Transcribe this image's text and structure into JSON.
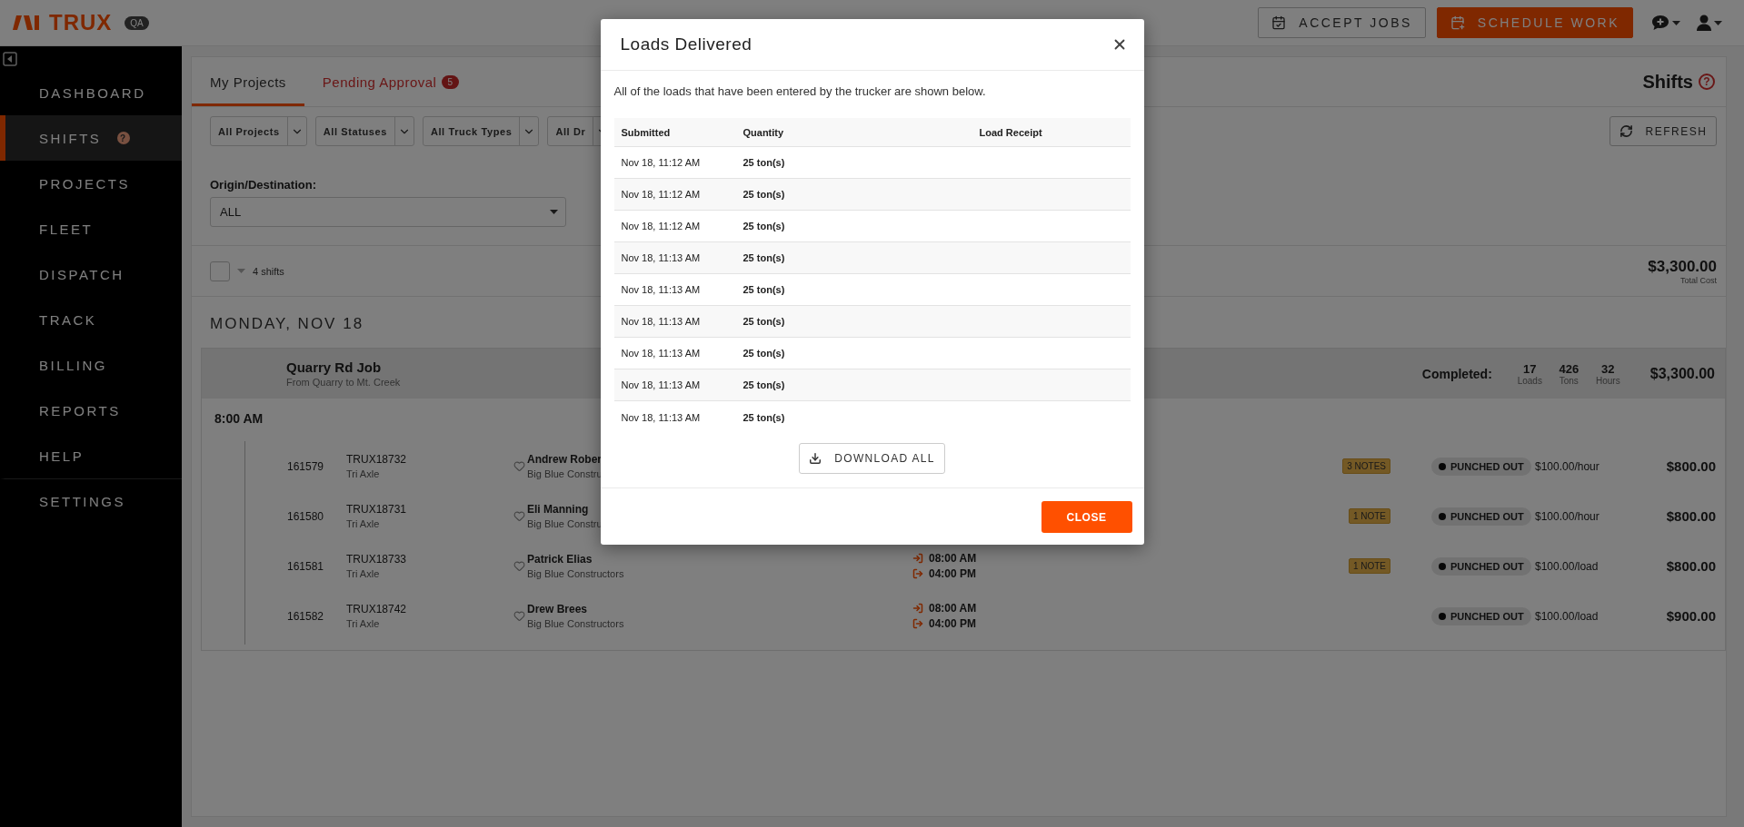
{
  "header": {
    "logo": "TRUX",
    "env_badge": "QA",
    "buttons": [
      {
        "label": "ACCEPT JOBS",
        "kind": "outline"
      },
      {
        "label": "SCHEDULE WORK",
        "kind": "primary"
      }
    ]
  },
  "sidebar": {
    "items": [
      {
        "label": "DASHBOARD",
        "selected": false,
        "has_help": false,
        "divider_before": false
      },
      {
        "label": "SHIFTS",
        "selected": true,
        "has_help": true,
        "help_mark": "?",
        "divider_before": false
      },
      {
        "label": "PROJECTS",
        "selected": false,
        "has_help": false,
        "divider_before": false
      },
      {
        "label": "FLEET",
        "selected": false,
        "has_help": false,
        "divider_before": false
      },
      {
        "label": "DISPATCH",
        "selected": false,
        "has_help": false,
        "divider_before": false
      },
      {
        "label": "TRACK",
        "selected": false,
        "has_help": false,
        "divider_before": false
      },
      {
        "label": "BILLING",
        "selected": false,
        "has_help": false,
        "divider_before": false
      },
      {
        "label": "REPORTS",
        "selected": false,
        "has_help": false,
        "divider_before": false
      },
      {
        "label": "HELP",
        "selected": false,
        "has_help": false,
        "divider_before": false
      },
      {
        "label": "SETTINGS",
        "selected": false,
        "has_help": false,
        "divider_before": true
      }
    ]
  },
  "tabs": [
    {
      "label": "My Projects",
      "selected": true
    },
    {
      "label": "Pending Approval",
      "selected": false,
      "badge": "5"
    }
  ],
  "page_title": "Shifts",
  "page_help": "?",
  "filters": [
    "All Projects",
    "All Statuses",
    "All Truck Types",
    "All Dr"
  ],
  "refresh_button": "REFRESH",
  "origin_destination": {
    "label": "Origin/Destination:",
    "value": "ALL"
  },
  "summary": {
    "select_all_checked": false,
    "count": "4 shifts",
    "total": "$3,300.00",
    "total_label": "Total Cost"
  },
  "day": {
    "heading": "MONDAY, NOV 18",
    "job": {
      "title": "Quarry Rd Job",
      "route": "From Quarry to Mt. Creek",
      "completed_label": "Completed:",
      "stats": [
        {
          "value": "17",
          "label": "Loads"
        },
        {
          "value": "426",
          "label": "Tons"
        },
        {
          "value": "32",
          "label": "Hours"
        }
      ],
      "total": "$3,300.00"
    },
    "time_group": "8:00 AM",
    "shifts": [
      {
        "id": "161579",
        "truck": "TRUX18732",
        "truck_type": "Tri Axle",
        "driver": "Andrew Rober",
        "company": "Big Blue Constru",
        "notes": "3 NOTES",
        "status": "PUNCHED OUT",
        "rate": "$100.00/hour",
        "amount": "$800.00"
      },
      {
        "id": "161580",
        "truck": "TRUX18731",
        "truck_type": "Tri Axle",
        "driver": "Eli Manning",
        "company": "Big Blue Constru",
        "notes": "1 NOTE",
        "status": "PUNCHED OUT",
        "rate": "$100.00/hour",
        "amount": "$800.00"
      },
      {
        "id": "161581",
        "truck": "TRUX18733",
        "truck_type": "Tri Axle",
        "driver": "Patrick Elias",
        "company": "Big Blue Constructors",
        "times": [
          {
            "kind": "in",
            "time": "08:00 AM"
          },
          {
            "kind": "out",
            "time": "04:00 PM"
          }
        ],
        "notes": "1 NOTE",
        "status": "PUNCHED OUT",
        "rate": "$100.00/load",
        "amount": "$800.00"
      },
      {
        "id": "161582",
        "truck": "TRUX18742",
        "truck_type": "Tri Axle",
        "driver": "Drew Brees",
        "company": "Big Blue Constructors",
        "times": [
          {
            "kind": "in",
            "time": "08:00 AM"
          },
          {
            "kind": "out",
            "time": "04:00 PM"
          }
        ],
        "status": "PUNCHED OUT",
        "rate": "$100.00/load",
        "amount": "$900.00"
      }
    ]
  },
  "modal": {
    "title": "Loads Delivered",
    "description": "All of the loads that have been entered by the trucker are shown below.",
    "columns": [
      "Submitted",
      "Quantity",
      "Load Receipt"
    ],
    "rows": [
      {
        "submitted": "Nov 18, 11:12 AM",
        "quantity": "25 ton(s)"
      },
      {
        "submitted": "Nov 18, 11:12 AM",
        "quantity": "25 ton(s)"
      },
      {
        "submitted": "Nov 18, 11:12 AM",
        "quantity": "25 ton(s)"
      },
      {
        "submitted": "Nov 18, 11:13 AM",
        "quantity": "25 ton(s)"
      },
      {
        "submitted": "Nov 18, 11:13 AM",
        "quantity": "25 ton(s)"
      },
      {
        "submitted": "Nov 18, 11:13 AM",
        "quantity": "25 ton(s)"
      },
      {
        "submitted": "Nov 18, 11:13 AM",
        "quantity": "25 ton(s)"
      },
      {
        "submitted": "Nov 18, 11:13 AM",
        "quantity": "25 ton(s)"
      },
      {
        "submitted": "Nov 18, 11:13 AM",
        "quantity": "25 ton(s)"
      }
    ],
    "download_button": "DOWNLOAD ALL",
    "close_button": "CLOSE"
  }
}
